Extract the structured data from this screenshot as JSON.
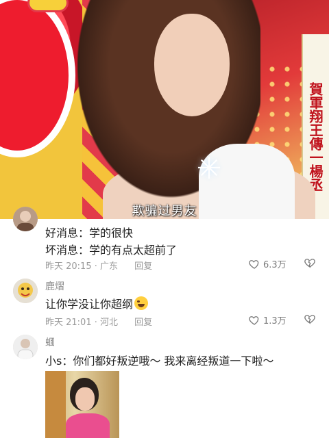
{
  "video": {
    "subtitle": "欺骗过男友",
    "side_caption": "賀軍翔王傳一楊丞"
  },
  "comments": [
    {
      "nickname": "",
      "lines": [
        "好消息：学的很快",
        "坏消息：学的有点太超前了"
      ],
      "time": "昨天 20:15",
      "location": "广东",
      "reply_label": "回复",
      "likes": "6.3万"
    },
    {
      "nickname": "鹿熠",
      "lines": [
        "让你学没让你超纲"
      ],
      "emoji": "crying-laughing-emoji",
      "time": "昨天 21:01",
      "location": "河北",
      "reply_label": "回复",
      "likes": "1.3万"
    },
    {
      "nickname": "蜖",
      "lines": [
        "小s：你们都好叛逆哦～ 我来离经叛道一下啦～"
      ]
    }
  ],
  "colors": {
    "text_primary": "#1f1f1f",
    "text_secondary": "#9a9a9a",
    "subtitle": "#ffffff"
  }
}
